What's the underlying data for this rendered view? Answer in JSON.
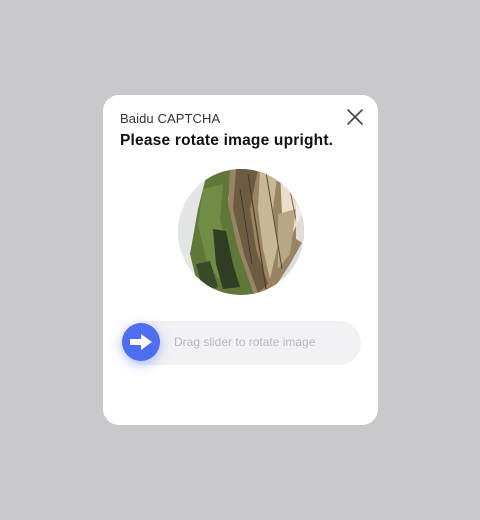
{
  "dialog": {
    "brand": "Baidu CAPTCHA",
    "title": "Please rotate image upright.",
    "close_icon": "close-icon"
  },
  "captcha_image": {
    "description_icon": "rotated-landscape-image"
  },
  "slider": {
    "hint": "Drag slider to rotate image",
    "knob_icon": "arrow-right-icon",
    "accent": "#4e6ef2",
    "rotation_progress": 0
  },
  "colors": {
    "background": "#c9c8cb",
    "dialog": "#ffffff",
    "track": "#f2f2f4"
  }
}
